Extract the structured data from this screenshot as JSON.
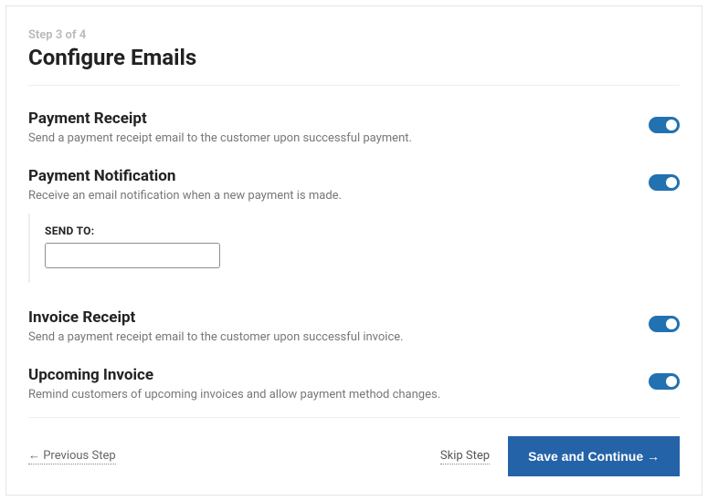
{
  "step_indicator": "Step 3 of 4",
  "page_title": "Configure Emails",
  "sections": {
    "payment_receipt": {
      "title": "Payment Receipt",
      "desc": "Send a payment receipt email to the customer upon successful payment.",
      "enabled": true
    },
    "payment_notification": {
      "title": "Payment Notification",
      "desc": "Receive an email notification when a new payment is made.",
      "enabled": true,
      "send_to_label": "SEND TO:",
      "send_to_value": ""
    },
    "invoice_receipt": {
      "title": "Invoice Receipt",
      "desc": "Send a payment receipt email to the customer upon successful invoice.",
      "enabled": true
    },
    "upcoming_invoice": {
      "title": "Upcoming Invoice",
      "desc": "Remind customers of upcoming invoices and allow payment method changes.",
      "enabled": true
    }
  },
  "footer": {
    "previous": "← Previous Step",
    "skip": "Skip Step",
    "save": "Save and Continue →"
  }
}
